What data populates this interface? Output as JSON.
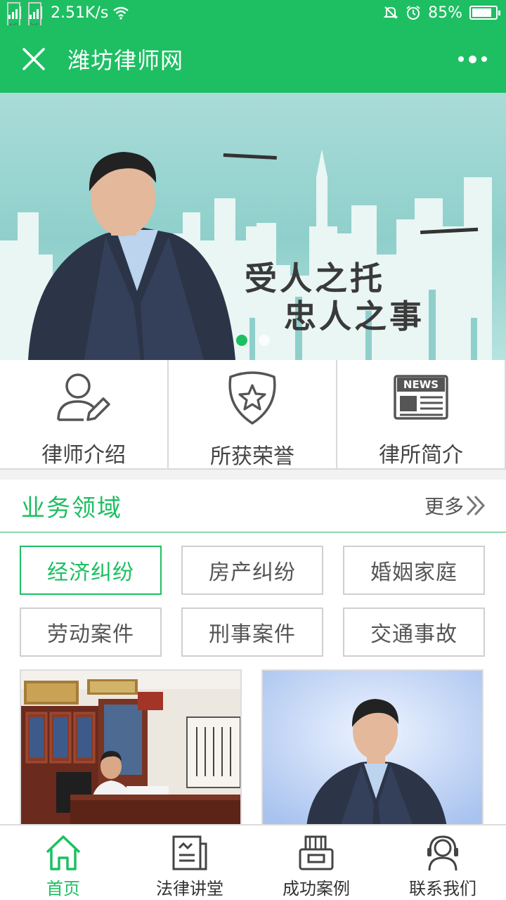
{
  "status_bar": {
    "net_speed": "2.51K/s",
    "signal1_tag": "4G",
    "signal2_tag": "2G",
    "battery": "85%",
    "battery_level": 0.85,
    "icons": [
      "signal-icon",
      "signal-icon",
      "wifi-icon",
      "mute-icon",
      "alarm-icon",
      "battery-icon"
    ]
  },
  "titlebar": {
    "title": "潍坊律师网",
    "close_icon": "close-icon",
    "menu_icon": "more-icon"
  },
  "banner": {
    "slogan_line1": "受人之托",
    "slogan_line2": "忠人之事",
    "slides": 2,
    "active_slide": 1
  },
  "quick_links": [
    {
      "label": "律师介绍",
      "icon": "user-edit-icon"
    },
    {
      "label": "所获荣誉",
      "icon": "badge-star-icon"
    },
    {
      "label": "律所简介",
      "icon": "news-icon"
    }
  ],
  "section": {
    "title": "业务领域",
    "more": "更多"
  },
  "tags": [
    {
      "label": "经济纠纷",
      "active": true
    },
    {
      "label": "房产纠纷",
      "active": false
    },
    {
      "label": "婚姻家庭",
      "active": false
    },
    {
      "label": "劳动案件",
      "active": false
    },
    {
      "label": "刑事案件",
      "active": false
    },
    {
      "label": "交通事故",
      "active": false
    }
  ],
  "photos": [
    {
      "name": "office-photo"
    },
    {
      "name": "portrait-photo"
    }
  ],
  "tabbar": [
    {
      "label": "首页",
      "icon": "home-icon",
      "active": true
    },
    {
      "label": "法律讲堂",
      "icon": "lecture-icon",
      "active": false
    },
    {
      "label": "成功案例",
      "icon": "case-icon",
      "active": false
    },
    {
      "label": "联系我们",
      "icon": "headset-icon",
      "active": false
    }
  ],
  "colors": {
    "accent": "#1dbf62",
    "border": "#d9d9d9",
    "text": "#444444"
  }
}
